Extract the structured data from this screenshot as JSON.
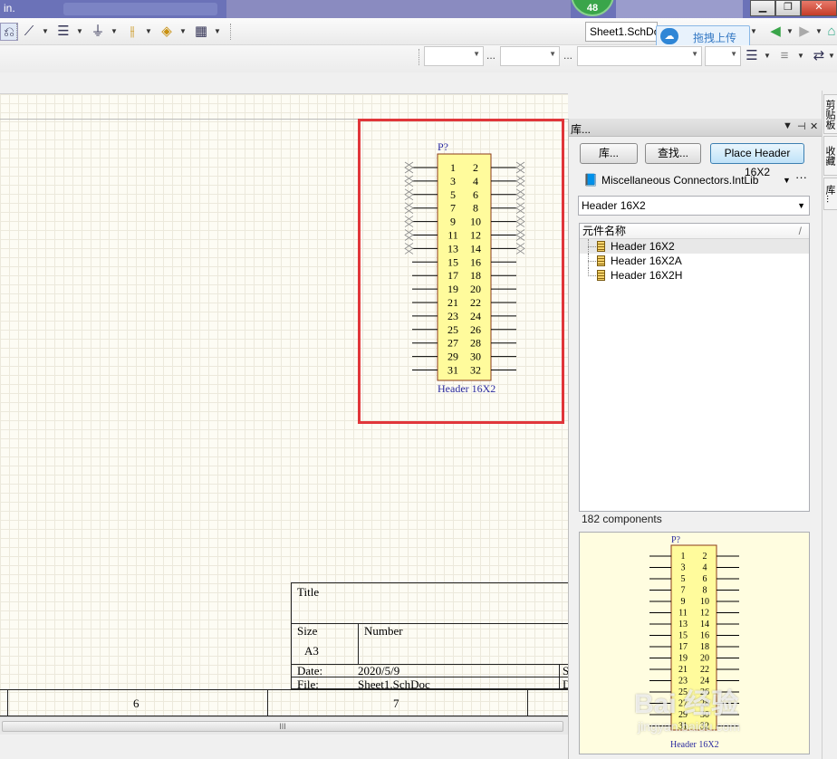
{
  "window": {
    "title_fragment": "in.",
    "notification_count": "48",
    "buttons": {
      "minimize": "▁",
      "restore": "❐",
      "close": "✕"
    }
  },
  "toolbar": {
    "doc_tab": "Sheet1.SchDoc",
    "upload_label": "拖拽上传",
    "dots": "..."
  },
  "schematic": {
    "designator": "P?",
    "comment": "Header 16X2",
    "left_pins": [
      "1",
      "3",
      "5",
      "7",
      "9",
      "11",
      "13",
      "15",
      "17",
      "19",
      "21",
      "23",
      "25",
      "27",
      "29",
      "31"
    ],
    "right_pins": [
      "2",
      "4",
      "6",
      "8",
      "10",
      "12",
      "14",
      "16",
      "18",
      "20",
      "22",
      "24",
      "26",
      "28",
      "30",
      "32"
    ]
  },
  "title_block": {
    "title_label": "Title",
    "size_label": "Size",
    "size_value": "A3",
    "number_label": "Number",
    "date_label": "Date:",
    "date_value": "2020/5/9",
    "file_label": "File:",
    "file_value": "Sheet1.SchDoc",
    "cut_s": "S",
    "cut_d": "D"
  },
  "zones": [
    "6",
    "7"
  ],
  "scroll_grip": "III",
  "library": {
    "panel_title": "库...",
    "header_controls": {
      "menu": "▼",
      "pin": "⊣",
      "close": "✕"
    },
    "btn_libraries": "库...",
    "btn_search": "查找...",
    "btn_place": "Place Header 16X2",
    "selected_lib": "Miscellaneous Connectors.IntLib",
    "filter": "Header 16X2",
    "column_header": "元件名称",
    "column_sort": "/",
    "items": [
      "Header 16X2",
      "Header 16X2A",
      "Header 16X2H"
    ],
    "count": "182 components",
    "preview": {
      "designator": "P?",
      "comment": "Header 16X2"
    }
  },
  "right_dock_tabs": [
    "剪贴板",
    "收藏",
    "库..."
  ],
  "watermark": {
    "text": "Bai 经验",
    "url": "jingyan.baidu.com"
  }
}
